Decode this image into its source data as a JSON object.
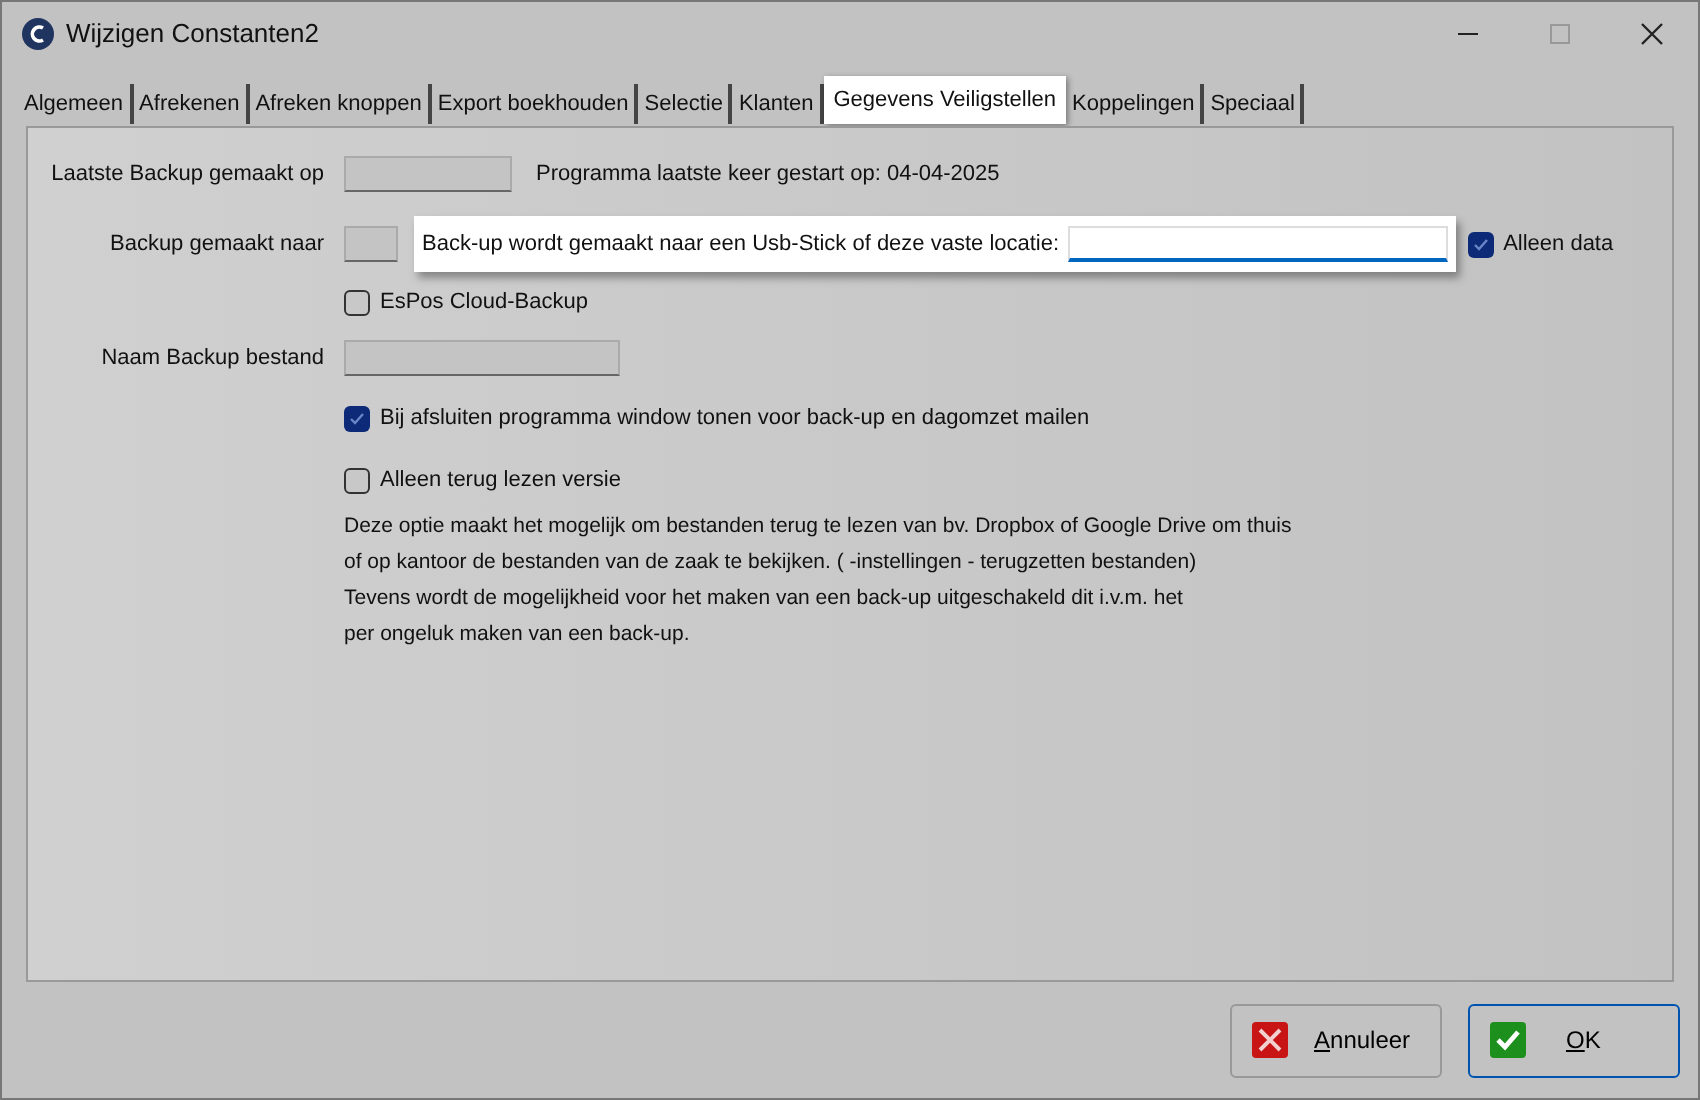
{
  "window": {
    "title": "Wijzigen Constanten2"
  },
  "tabs": [
    {
      "label": "Algemeen",
      "selected": false
    },
    {
      "label": "Afrekenen",
      "selected": false
    },
    {
      "label": "Afreken knoppen",
      "selected": false
    },
    {
      "label": "Export boekhouden",
      "selected": false
    },
    {
      "label": "Selectie",
      "selected": false
    },
    {
      "label": "Klanten",
      "selected": false
    },
    {
      "label": "Gegevens Veiligstellen",
      "selected": true
    },
    {
      "label": "Koppelingen",
      "selected": false
    },
    {
      "label": "Speciaal",
      "selected": false
    }
  ],
  "last_backup": {
    "label": "Laatste Backup gemaakt op",
    "started_label": "Programma laatste keer gestart op:",
    "started_date": "04-04-2025"
  },
  "backup_to": {
    "label": "Backup gemaakt naar",
    "prompt": "Back-up wordt gemaakt naar een Usb-Stick of deze vaste locatie:",
    "only_data": {
      "label": "Alleen data",
      "checked": true
    }
  },
  "cloud_backup": {
    "label": "EsPos Cloud-Backup",
    "checked": false
  },
  "file_name": {
    "label": "Naam Backup bestand"
  },
  "show_on_close": {
    "label": "Bij afsluiten programma window tonen voor back-up en dagomzet mailen",
    "checked": true
  },
  "read_only": {
    "label": "Alleen terug lezen versie",
    "checked": false
  },
  "description": [
    "Deze optie maakt het mogelijk om bestanden terug te lezen van bv. Dropbox of Google Drive om thuis",
    "of op kantoor de bestanden van de zaak te bekijken. ( -instellingen - terugzetten bestanden)",
    "Tevens wordt de mogelijkheid voor het maken van een back-up uitgeschakeld dit i.v.m. het",
    "per ongeluk maken van een back-up."
  ],
  "buttons": [
    {
      "label": "Annuleer",
      "kind": "cancel"
    },
    {
      "label": "OK",
      "kind": "ok"
    }
  ]
}
